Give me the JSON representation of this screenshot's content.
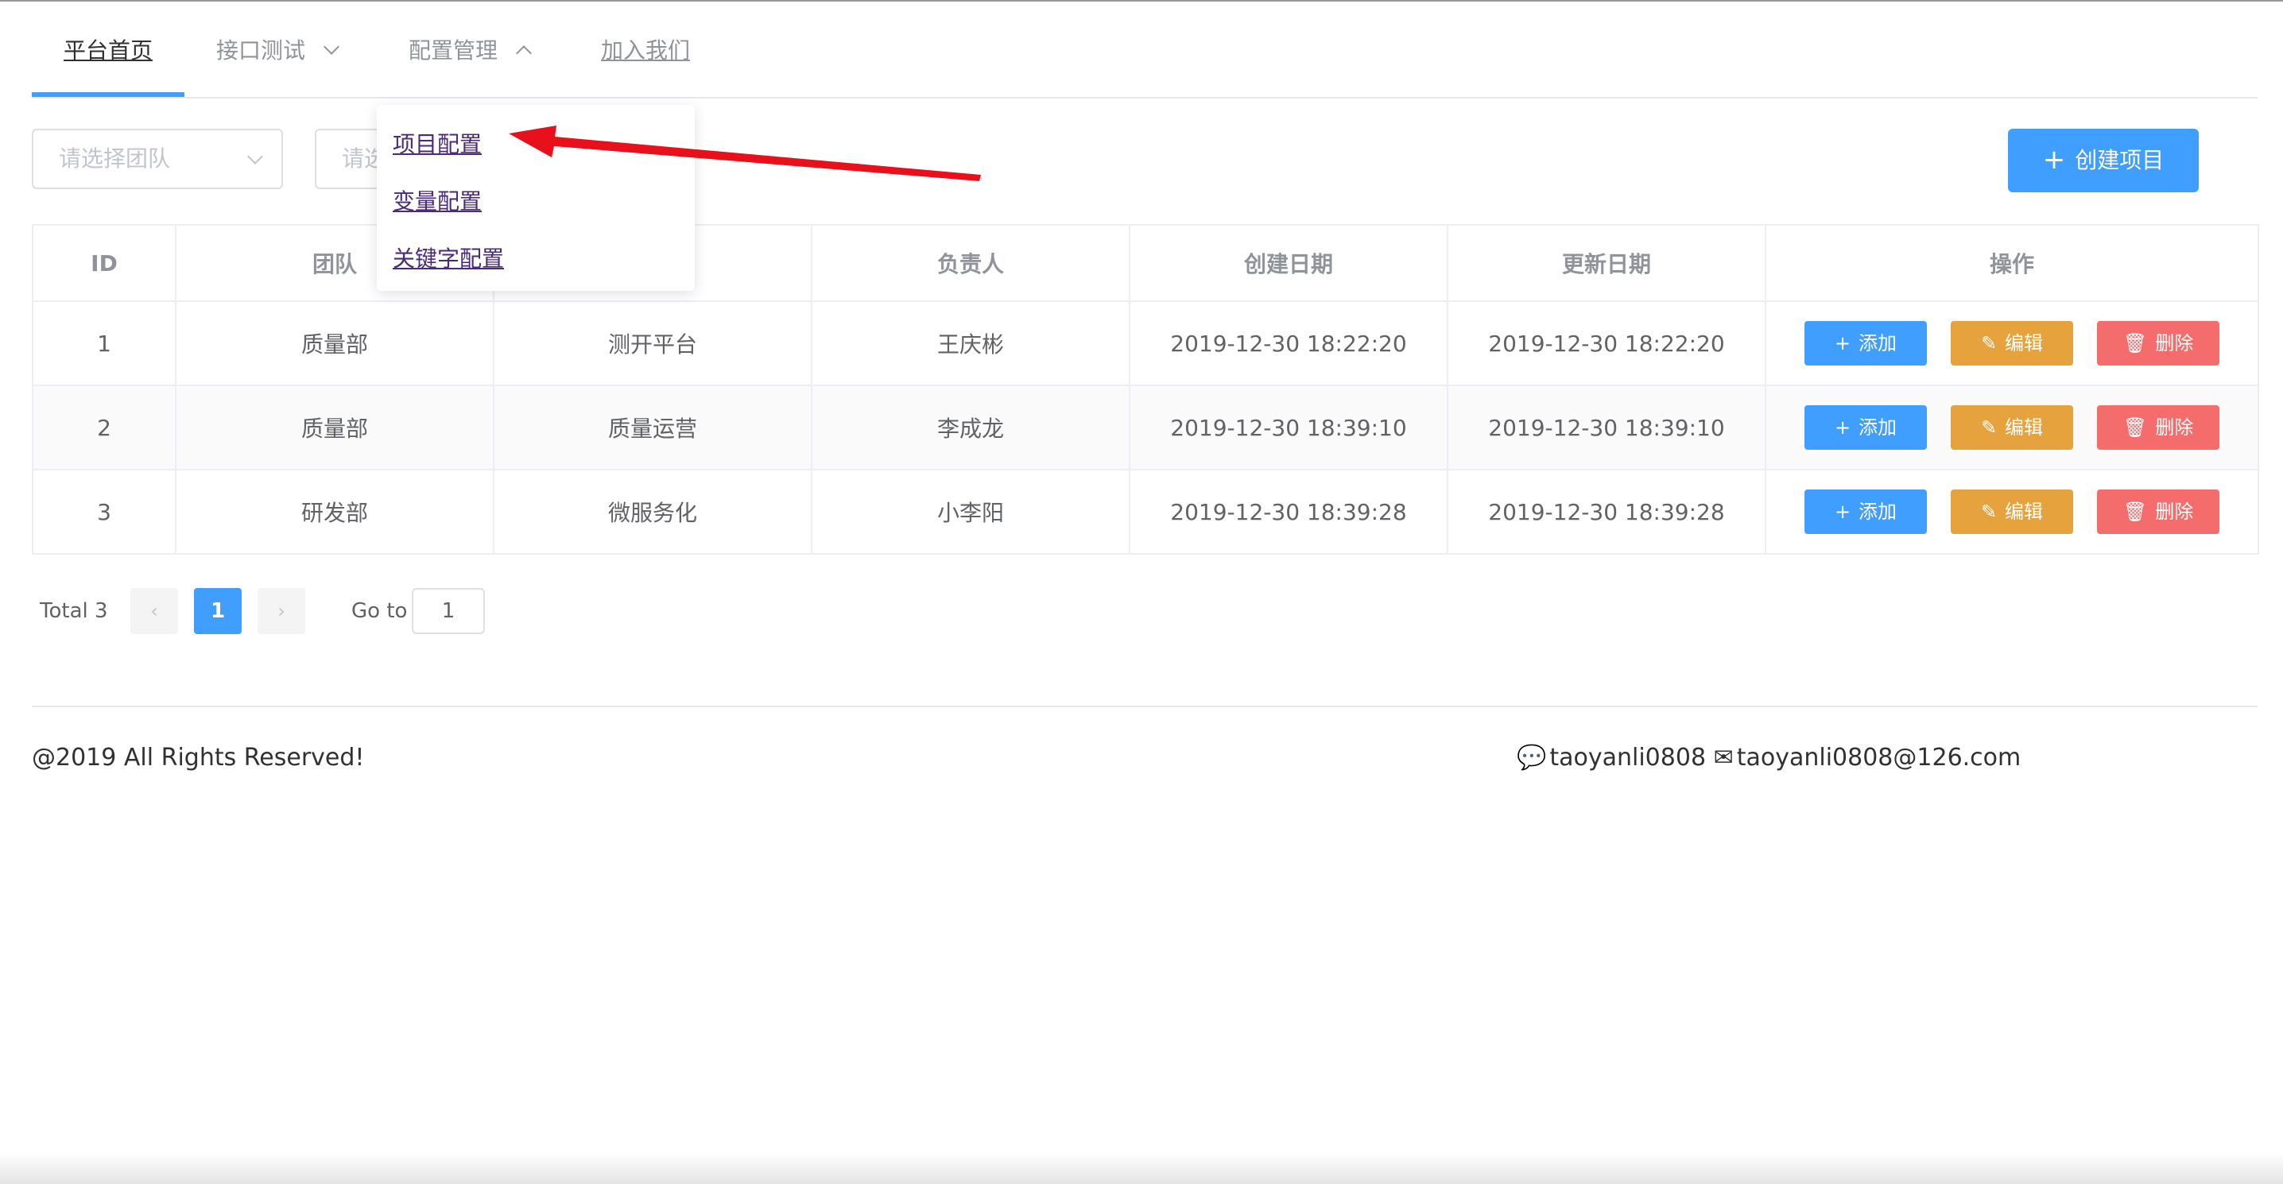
{
  "nav": {
    "items": [
      {
        "label": "平台首页"
      },
      {
        "label": "接口测试"
      },
      {
        "label": "配置管理"
      },
      {
        "label": "加入我们"
      }
    ]
  },
  "dropdown": {
    "items": [
      {
        "label": "项目配置"
      },
      {
        "label": "变量配置"
      },
      {
        "label": "关键字配置"
      }
    ]
  },
  "filters": {
    "team_placeholder": "请选择团队",
    "project_placeholder": "请选"
  },
  "create_button": {
    "label": "创建项目"
  },
  "table": {
    "headers": [
      "ID",
      "团队",
      "",
      "负责人",
      "创建日期",
      "更新日期",
      "操作"
    ],
    "rows": [
      {
        "id": "1",
        "team": "质量部",
        "project": "测开平台",
        "owner": "王庆彬",
        "created": "2019-12-30 18:22:20",
        "updated": "2019-12-30 18:22:20"
      },
      {
        "id": "2",
        "team": "质量部",
        "project": "质量运营",
        "owner": "李成龙",
        "created": "2019-12-30 18:39:10",
        "updated": "2019-12-30 18:39:10"
      },
      {
        "id": "3",
        "team": "研发部",
        "project": "微服务化",
        "owner": "小李阳",
        "created": "2019-12-30 18:39:28",
        "updated": "2019-12-30 18:39:28"
      }
    ],
    "actions": {
      "add": "添加",
      "edit": "编辑",
      "delete": "删除"
    }
  },
  "pagination": {
    "total_label": "Total 3",
    "current_page": "1",
    "goto_label": "Go to",
    "goto_value": "1"
  },
  "footer": {
    "copyright": "@2019 All Rights Reserved!",
    "wechat": "taoyanli0808",
    "email": "taoyanli0808@126.com"
  },
  "colors": {
    "primary": "#409eff",
    "warning": "#e6a23c",
    "danger": "#f56c6c",
    "annotation_arrow": "#e8101a"
  },
  "icons": [
    "chevron-down-icon",
    "chevron-up-icon",
    "plus-icon",
    "edit-icon",
    "trash-icon",
    "chevron-left-icon",
    "chevron-right-icon",
    "chat-icon",
    "mail-icon"
  ]
}
